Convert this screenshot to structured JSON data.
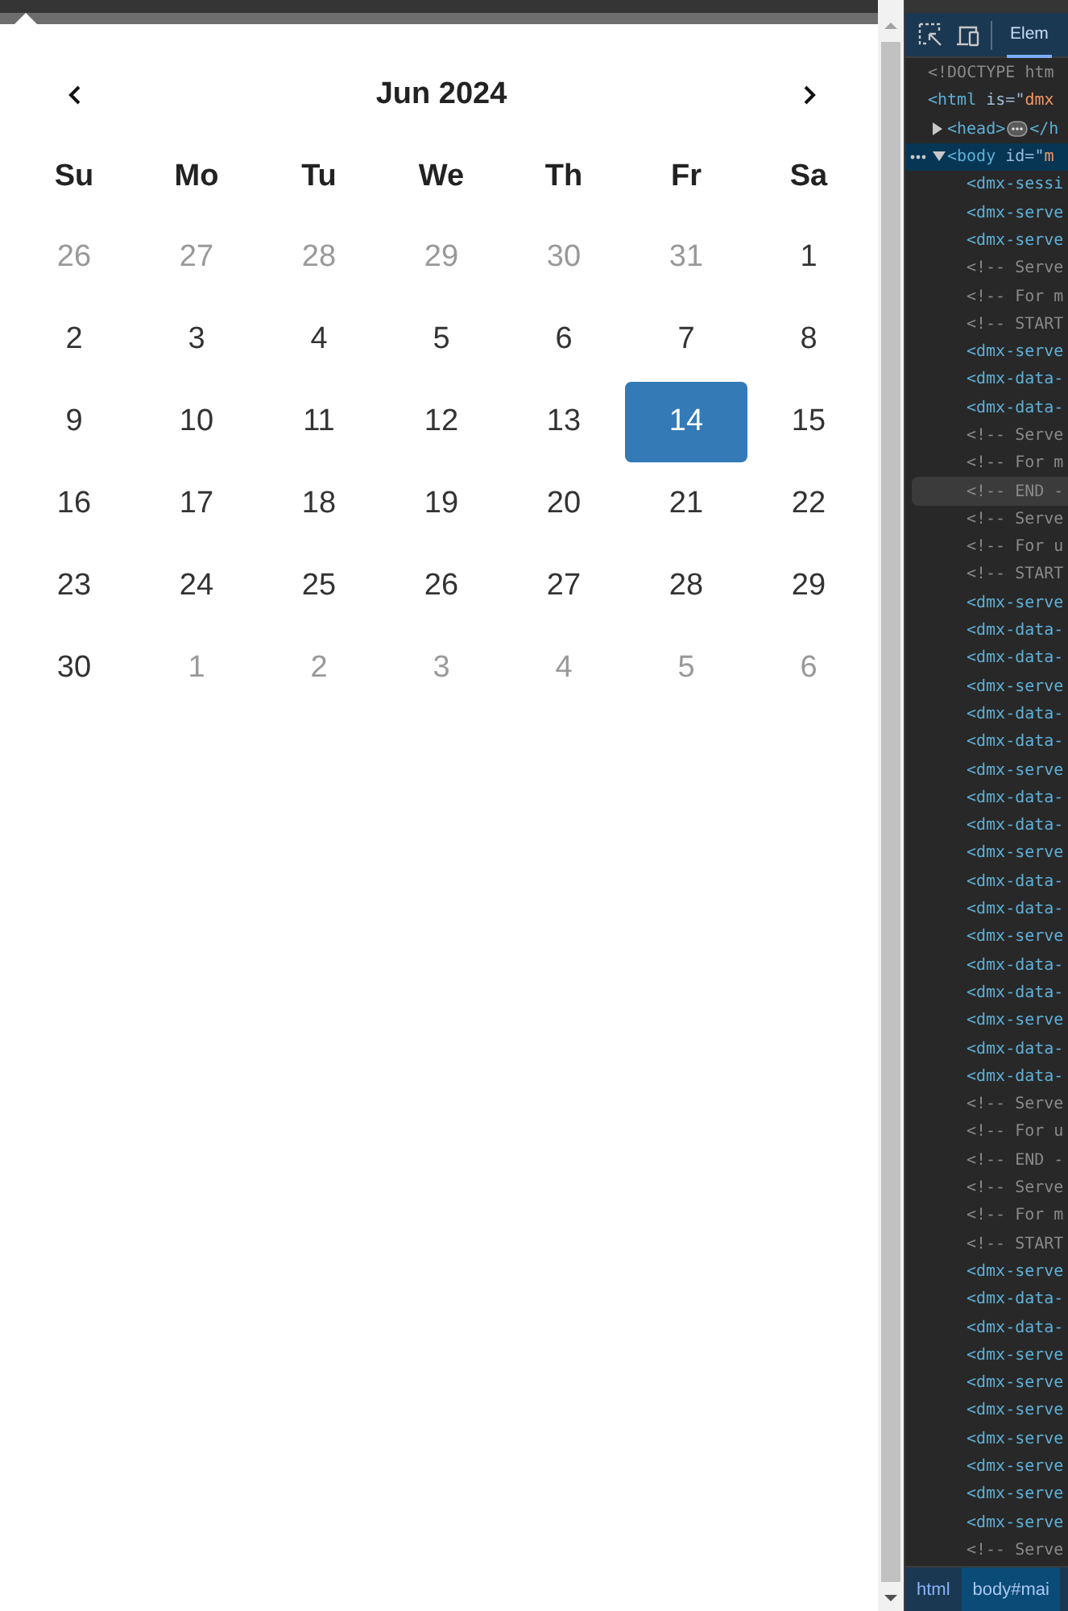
{
  "calendar": {
    "month_label": "Jun 2024",
    "weekdays": [
      "Su",
      "Mo",
      "Tu",
      "We",
      "Th",
      "Fr",
      "Sa"
    ],
    "weeks": [
      [
        {
          "label": "26",
          "muted": true,
          "selected": false
        },
        {
          "label": "27",
          "muted": true,
          "selected": false
        },
        {
          "label": "28",
          "muted": true,
          "selected": false
        },
        {
          "label": "29",
          "muted": true,
          "selected": false
        },
        {
          "label": "30",
          "muted": true,
          "selected": false
        },
        {
          "label": "31",
          "muted": true,
          "selected": false
        },
        {
          "label": "1",
          "muted": false,
          "selected": false
        }
      ],
      [
        {
          "label": "2",
          "muted": false,
          "selected": false
        },
        {
          "label": "3",
          "muted": false,
          "selected": false
        },
        {
          "label": "4",
          "muted": false,
          "selected": false
        },
        {
          "label": "5",
          "muted": false,
          "selected": false
        },
        {
          "label": "6",
          "muted": false,
          "selected": false
        },
        {
          "label": "7",
          "muted": false,
          "selected": false
        },
        {
          "label": "8",
          "muted": false,
          "selected": false
        }
      ],
      [
        {
          "label": "9",
          "muted": false,
          "selected": false
        },
        {
          "label": "10",
          "muted": false,
          "selected": false
        },
        {
          "label": "11",
          "muted": false,
          "selected": false
        },
        {
          "label": "12",
          "muted": false,
          "selected": false
        },
        {
          "label": "13",
          "muted": false,
          "selected": false
        },
        {
          "label": "14",
          "muted": false,
          "selected": true
        },
        {
          "label": "15",
          "muted": false,
          "selected": false
        }
      ],
      [
        {
          "label": "16",
          "muted": false,
          "selected": false
        },
        {
          "label": "17",
          "muted": false,
          "selected": false
        },
        {
          "label": "18",
          "muted": false,
          "selected": false
        },
        {
          "label": "19",
          "muted": false,
          "selected": false
        },
        {
          "label": "20",
          "muted": false,
          "selected": false
        },
        {
          "label": "21",
          "muted": false,
          "selected": false
        },
        {
          "label": "22",
          "muted": false,
          "selected": false
        }
      ],
      [
        {
          "label": "23",
          "muted": false,
          "selected": false
        },
        {
          "label": "24",
          "muted": false,
          "selected": false
        },
        {
          "label": "25",
          "muted": false,
          "selected": false
        },
        {
          "label": "26",
          "muted": false,
          "selected": false
        },
        {
          "label": "27",
          "muted": false,
          "selected": false
        },
        {
          "label": "28",
          "muted": false,
          "selected": false
        },
        {
          "label": "29",
          "muted": false,
          "selected": false
        }
      ],
      [
        {
          "label": "30",
          "muted": false,
          "selected": false
        },
        {
          "label": "1",
          "muted": true,
          "selected": false
        },
        {
          "label": "2",
          "muted": true,
          "selected": false
        },
        {
          "label": "3",
          "muted": true,
          "selected": false
        },
        {
          "label": "4",
          "muted": true,
          "selected": false
        },
        {
          "label": "5",
          "muted": true,
          "selected": false
        },
        {
          "label": "6",
          "muted": true,
          "selected": false
        }
      ]
    ]
  },
  "devtools": {
    "tabs": [
      {
        "label": "Elem",
        "selected": true
      }
    ],
    "dom_tree": [
      {
        "parts": [
          {
            "text": "<!DOCTYPE htm",
            "kind": "comment"
          }
        ],
        "selected": false,
        "hovered": false
      },
      {
        "parts": [
          {
            "text": "<html",
            "kind": "tag"
          },
          {
            "text": " is",
            "kind": "attr"
          },
          {
            "text": "=\"",
            "kind": "punct"
          },
          {
            "text": "dmx",
            "kind": "value"
          }
        ],
        "selected": false,
        "hovered": false,
        "children": [
          {
            "parts": [
              {
                "text": "<head>",
                "kind": "tag"
              }
            ],
            "close_parts": [
              {
                "text": "</h",
                "kind": "tag"
              }
            ],
            "expanded": false,
            "selected": false,
            "hovered": false
          },
          {
            "parts": [
              {
                "text": "<body",
                "kind": "tag"
              },
              {
                "text": " id",
                "kind": "attr"
              },
              {
                "text": "=\"",
                "kind": "punct"
              },
              {
                "text": "m",
                "kind": "value"
              }
            ],
            "expanded": true,
            "selected": true,
            "hovered": false,
            "children": [
              {
                "parts": [
                  {
                    "text": "<dmx-sessi",
                    "kind": "tag"
                  }
                ],
                "selected": false,
                "hovered": false
              },
              {
                "parts": [
                  {
                    "text": "<dmx-serve",
                    "kind": "tag"
                  }
                ],
                "selected": false,
                "hovered": false
              },
              {
                "parts": [
                  {
                    "text": "<dmx-serve",
                    "kind": "tag"
                  }
                ],
                "selected": false,
                "hovered": false
              },
              {
                "parts": [
                  {
                    "text": "<!-- Serve",
                    "kind": "comment"
                  }
                ],
                "selected": false,
                "hovered": false
              },
              {
                "parts": [
                  {
                    "text": "<!-- For m",
                    "kind": "comment"
                  }
                ],
                "selected": false,
                "hovered": false
              },
              {
                "parts": [
                  {
                    "text": "<!-- START",
                    "kind": "comment"
                  }
                ],
                "selected": false,
                "hovered": false
              },
              {
                "parts": [
                  {
                    "text": "<dmx-serve",
                    "kind": "tag"
                  }
                ],
                "selected": false,
                "hovered": false
              },
              {
                "parts": [
                  {
                    "text": "<dmx-data-",
                    "kind": "tag"
                  }
                ],
                "selected": false,
                "hovered": false
              },
              {
                "parts": [
                  {
                    "text": "<dmx-data-",
                    "kind": "tag"
                  }
                ],
                "selected": false,
                "hovered": false
              },
              {
                "parts": [
                  {
                    "text": "<!-- Serve",
                    "kind": "comment"
                  }
                ],
                "selected": false,
                "hovered": false
              },
              {
                "parts": [
                  {
                    "text": "<!-- For m",
                    "kind": "comment"
                  }
                ],
                "selected": false,
                "hovered": false
              },
              {
                "parts": [
                  {
                    "text": "<!-- END -",
                    "kind": "comment"
                  }
                ],
                "selected": false,
                "hovered": true
              },
              {
                "parts": [
                  {
                    "text": "<!-- Serve",
                    "kind": "comment"
                  }
                ],
                "selected": false,
                "hovered": false
              },
              {
                "parts": [
                  {
                    "text": "<!-- For u",
                    "kind": "comment"
                  }
                ],
                "selected": false,
                "hovered": false
              },
              {
                "parts": [
                  {
                    "text": "<!-- START",
                    "kind": "comment"
                  }
                ],
                "selected": false,
                "hovered": false
              },
              {
                "parts": [
                  {
                    "text": "<dmx-serve",
                    "kind": "tag"
                  }
                ],
                "selected": false,
                "hovered": false
              },
              {
                "parts": [
                  {
                    "text": "<dmx-data-",
                    "kind": "tag"
                  }
                ],
                "selected": false,
                "hovered": false
              },
              {
                "parts": [
                  {
                    "text": "<dmx-data-",
                    "kind": "tag"
                  }
                ],
                "selected": false,
                "hovered": false
              },
              {
                "parts": [
                  {
                    "text": "<dmx-serve",
                    "kind": "tag"
                  }
                ],
                "selected": false,
                "hovered": false
              },
              {
                "parts": [
                  {
                    "text": "<dmx-data-",
                    "kind": "tag"
                  }
                ],
                "selected": false,
                "hovered": false
              },
              {
                "parts": [
                  {
                    "text": "<dmx-data-",
                    "kind": "tag"
                  }
                ],
                "selected": false,
                "hovered": false
              },
              {
                "parts": [
                  {
                    "text": "<dmx-serve",
                    "kind": "tag"
                  }
                ],
                "selected": false,
                "hovered": false
              },
              {
                "parts": [
                  {
                    "text": "<dmx-data-",
                    "kind": "tag"
                  }
                ],
                "selected": false,
                "hovered": false
              },
              {
                "parts": [
                  {
                    "text": "<dmx-data-",
                    "kind": "tag"
                  }
                ],
                "selected": false,
                "hovered": false
              },
              {
                "parts": [
                  {
                    "text": "<dmx-serve",
                    "kind": "tag"
                  }
                ],
                "selected": false,
                "hovered": false
              },
              {
                "parts": [
                  {
                    "text": "<dmx-data-",
                    "kind": "tag"
                  }
                ],
                "selected": false,
                "hovered": false
              },
              {
                "parts": [
                  {
                    "text": "<dmx-data-",
                    "kind": "tag"
                  }
                ],
                "selected": false,
                "hovered": false
              },
              {
                "parts": [
                  {
                    "text": "<dmx-serve",
                    "kind": "tag"
                  }
                ],
                "selected": false,
                "hovered": false
              },
              {
                "parts": [
                  {
                    "text": "<dmx-data-",
                    "kind": "tag"
                  }
                ],
                "selected": false,
                "hovered": false
              },
              {
                "parts": [
                  {
                    "text": "<dmx-data-",
                    "kind": "tag"
                  }
                ],
                "selected": false,
                "hovered": false
              },
              {
                "parts": [
                  {
                    "text": "<dmx-serve",
                    "kind": "tag"
                  }
                ],
                "selected": false,
                "hovered": false
              },
              {
                "parts": [
                  {
                    "text": "<dmx-data-",
                    "kind": "tag"
                  }
                ],
                "selected": false,
                "hovered": false
              },
              {
                "parts": [
                  {
                    "text": "<dmx-data-",
                    "kind": "tag"
                  }
                ],
                "selected": false,
                "hovered": false
              },
              {
                "parts": [
                  {
                    "text": "<!-- Serve",
                    "kind": "comment"
                  }
                ],
                "selected": false,
                "hovered": false
              },
              {
                "parts": [
                  {
                    "text": "<!-- For u",
                    "kind": "comment"
                  }
                ],
                "selected": false,
                "hovered": false
              },
              {
                "parts": [
                  {
                    "text": "<!-- END -",
                    "kind": "comment"
                  }
                ],
                "selected": false,
                "hovered": false
              },
              {
                "parts": [
                  {
                    "text": "<!-- Serve",
                    "kind": "comment"
                  }
                ],
                "selected": false,
                "hovered": false
              },
              {
                "parts": [
                  {
                    "text": "<!-- For m",
                    "kind": "comment"
                  }
                ],
                "selected": false,
                "hovered": false
              },
              {
                "parts": [
                  {
                    "text": "<!-- START",
                    "kind": "comment"
                  }
                ],
                "selected": false,
                "hovered": false
              },
              {
                "parts": [
                  {
                    "text": "<dmx-serve",
                    "kind": "tag"
                  }
                ],
                "selected": false,
                "hovered": false
              },
              {
                "parts": [
                  {
                    "text": "<dmx-data-",
                    "kind": "tag"
                  }
                ],
                "selected": false,
                "hovered": false
              },
              {
                "parts": [
                  {
                    "text": "<dmx-data-",
                    "kind": "tag"
                  }
                ],
                "selected": false,
                "hovered": false
              },
              {
                "parts": [
                  {
                    "text": "<dmx-serve",
                    "kind": "tag"
                  }
                ],
                "selected": false,
                "hovered": false
              },
              {
                "parts": [
                  {
                    "text": "<dmx-serve",
                    "kind": "tag"
                  }
                ],
                "selected": false,
                "hovered": false
              },
              {
                "parts": [
                  {
                    "text": "<dmx-serve",
                    "kind": "tag"
                  }
                ],
                "selected": false,
                "hovered": false
              },
              {
                "parts": [
                  {
                    "text": "<dmx-serve",
                    "kind": "tag"
                  }
                ],
                "selected": false,
                "hovered": false
              },
              {
                "parts": [
                  {
                    "text": "<dmx-serve",
                    "kind": "tag"
                  }
                ],
                "selected": false,
                "hovered": false
              },
              {
                "parts": [
                  {
                    "text": "<dmx-serve",
                    "kind": "tag"
                  }
                ],
                "selected": false,
                "hovered": false
              },
              {
                "parts": [
                  {
                    "text": "<dmx-serve",
                    "kind": "tag"
                  }
                ],
                "selected": false,
                "hovered": false
              },
              {
                "parts": [
                  {
                    "text": "<!-- Serve",
                    "kind": "comment"
                  }
                ],
                "selected": false,
                "hovered": false
              }
            ]
          }
        ]
      }
    ],
    "breadcrumbs": [
      {
        "label": "html",
        "selected": false
      },
      {
        "label": "body#mai",
        "selected": true
      }
    ]
  }
}
